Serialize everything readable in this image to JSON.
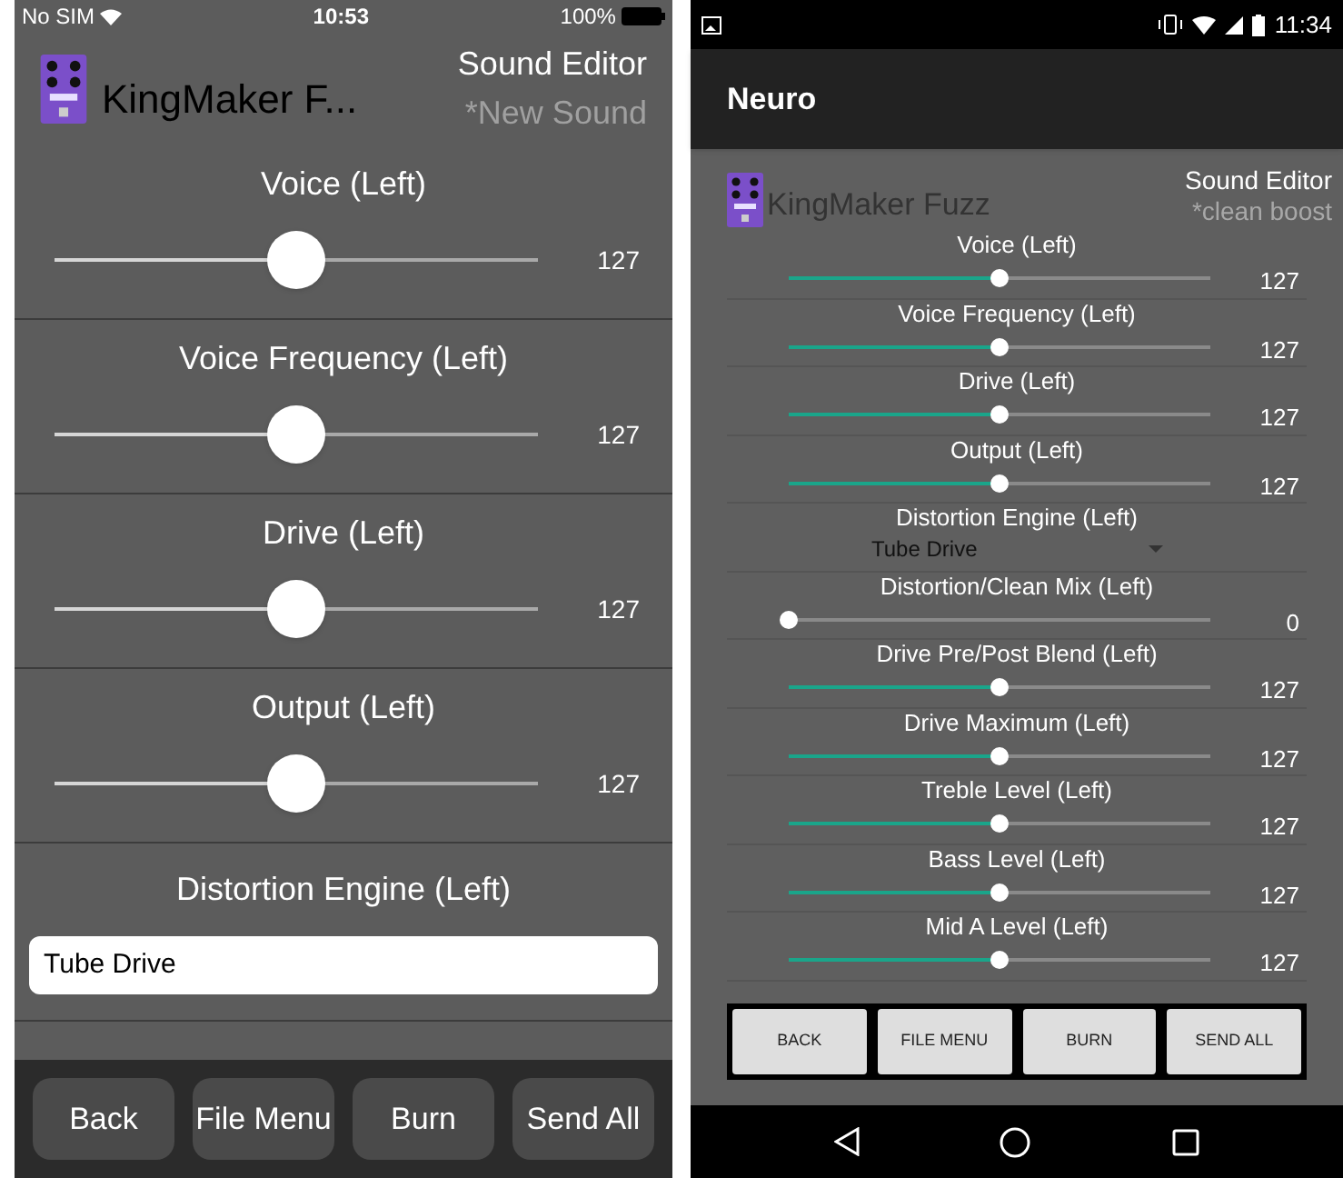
{
  "ios_screen": {
    "status_bar": {
      "carrier": "No SIM",
      "time": "10:53",
      "battery": "100%"
    },
    "header": {
      "device_name": "KingMaker F...",
      "title": "Sound Editor",
      "sound_name": "*New Sound"
    },
    "controls": [
      {
        "kind": "slider",
        "label": "Voice (Left)",
        "level": 0.5,
        "reading": "127"
      },
      {
        "kind": "slider",
        "label": "Voice Frequency (Left)",
        "level": 0.5,
        "reading": "127"
      },
      {
        "kind": "slider",
        "label": "Drive (Left)",
        "level": 0.5,
        "reading": "127"
      },
      {
        "kind": "slider",
        "label": "Output (Left)",
        "level": 0.5,
        "reading": "127"
      },
      {
        "kind": "dropdown",
        "label": "Distortion Engine (Left)",
        "value": "Tube Drive"
      }
    ],
    "buttons": [
      "Back",
      "File Menu",
      "Burn",
      "Send All"
    ]
  },
  "android_screen": {
    "status_bar": {
      "time": "11:34"
    },
    "app_bar": {
      "title": "Neuro"
    },
    "header": {
      "device_name": "KingMaker Fuzz",
      "title": "Sound Editor",
      "sound_name": "*clean boost"
    },
    "controls": [
      {
        "kind": "slider",
        "label": "Voice (Left)",
        "level": 0.5,
        "reading": "127"
      },
      {
        "kind": "slider",
        "label": "Voice Frequency (Left)",
        "level": 0.5,
        "reading": "127"
      },
      {
        "kind": "slider",
        "label": "Drive (Left)",
        "level": 0.5,
        "reading": "127"
      },
      {
        "kind": "slider",
        "label": "Output (Left)",
        "level": 0.5,
        "reading": "127"
      },
      {
        "kind": "dropdown",
        "label": "Distortion Engine (Left)",
        "value": "Tube Drive"
      },
      {
        "kind": "slider",
        "label": "Distortion/Clean Mix (Left)",
        "level": 0,
        "reading": "0"
      },
      {
        "kind": "slider",
        "label": "Drive Pre/Post Blend (Left)",
        "level": 0.5,
        "reading": "127"
      },
      {
        "kind": "slider",
        "label": "Drive Maximum (Left)",
        "level": 0.5,
        "reading": "127"
      },
      {
        "kind": "slider",
        "label": "Treble Level (Left)",
        "level": 0.5,
        "reading": "127"
      },
      {
        "kind": "slider",
        "label": "Bass Level (Left)",
        "level": 0.5,
        "reading": "127"
      },
      {
        "kind": "slider",
        "label": "Mid A Level (Left)",
        "level": 0.5,
        "reading": "127"
      }
    ],
    "buttons": [
      "BACK",
      "FILE MENU",
      "BURN",
      "SEND ALL"
    ]
  }
}
